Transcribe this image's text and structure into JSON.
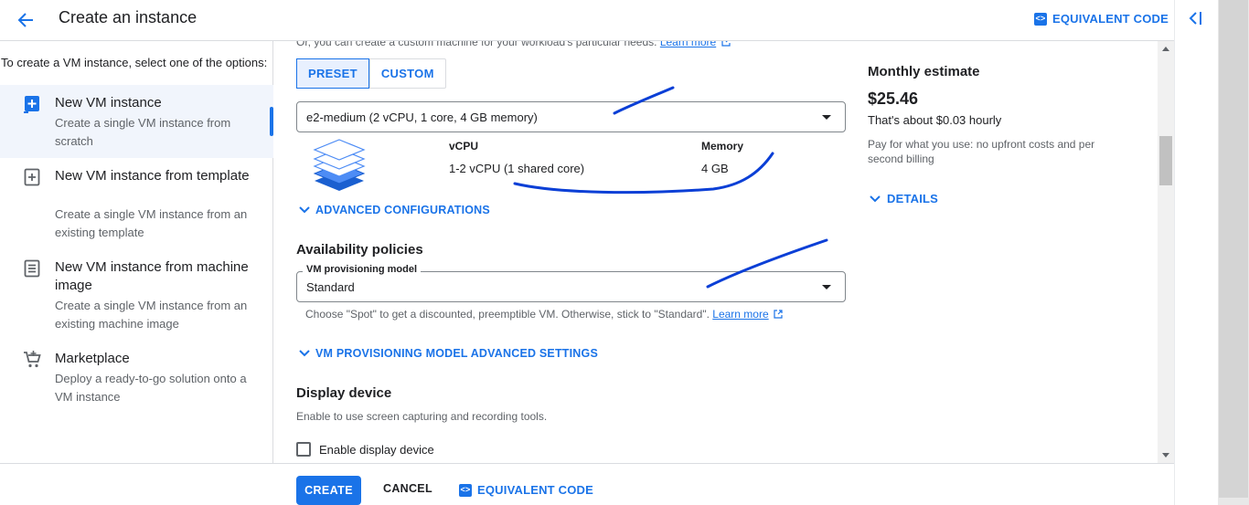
{
  "header": {
    "title": "Create an instance",
    "equivalent_code": "EQUIVALENT CODE",
    "code_badge": "<>"
  },
  "left_panel": {
    "intro": "To create a VM instance, select one of the options:",
    "options": [
      {
        "title": "New VM instance",
        "desc": "Create a single VM instance from scratch",
        "icon": "plus-box-icon",
        "selected": true
      },
      {
        "title": "New VM instance from template",
        "desc": "Create a single VM instance from an existing template",
        "icon": "template-plus-icon",
        "selected": false
      },
      {
        "title": "New VM instance from machine image",
        "desc": "Create a single VM instance from an existing machine image",
        "icon": "machine-image-icon",
        "selected": false
      },
      {
        "title": "Marketplace",
        "desc": "Deploy a ready-to-go solution onto a VM instance",
        "icon": "cart-icon",
        "selected": false
      }
    ]
  },
  "machine": {
    "cut_text": "Or, you can create a custom machine for your workload's particular needs.",
    "learn_more": "Learn more",
    "tabs": [
      {
        "label": "PRESET",
        "active": true
      },
      {
        "label": "CUSTOM",
        "active": false
      }
    ],
    "type_value": "e2-medium (2 vCPU, 1 core, 4 GB memory)",
    "vcpu_label": "vCPU",
    "vcpu_value": "1-2 vCPU (1 shared core)",
    "memory_label": "Memory",
    "memory_value": "4 GB",
    "advanced": "ADVANCED CONFIGURATIONS"
  },
  "availability": {
    "heading": "Availability policies",
    "field_label": "VM provisioning model",
    "field_value": "Standard",
    "hint": "Choose \"Spot\" to get a discounted, preemptible VM. Otherwise, stick to \"Standard\".",
    "learn_more": "Learn more",
    "advanced": "VM PROVISIONING MODEL ADVANCED SETTINGS"
  },
  "display": {
    "heading": "Display device",
    "hint": "Enable to use screen capturing and recording tools.",
    "checkbox_label": "Enable display device",
    "checked": false
  },
  "estimate": {
    "heading": "Monthly estimate",
    "price": "$25.46",
    "hourly": "That's about $0.03 hourly",
    "note": "Pay for what you use: no upfront costs and per second billing",
    "details": "DETAILS"
  },
  "footer": {
    "create": "CREATE",
    "cancel": "CANCEL",
    "equivalent_code": "EQUIVALENT CODE",
    "code_badge": "<>"
  },
  "colors": {
    "accent": "#1a73e8",
    "annotation": "#0b3fd6",
    "selected_bg": "#f1f5fc"
  }
}
